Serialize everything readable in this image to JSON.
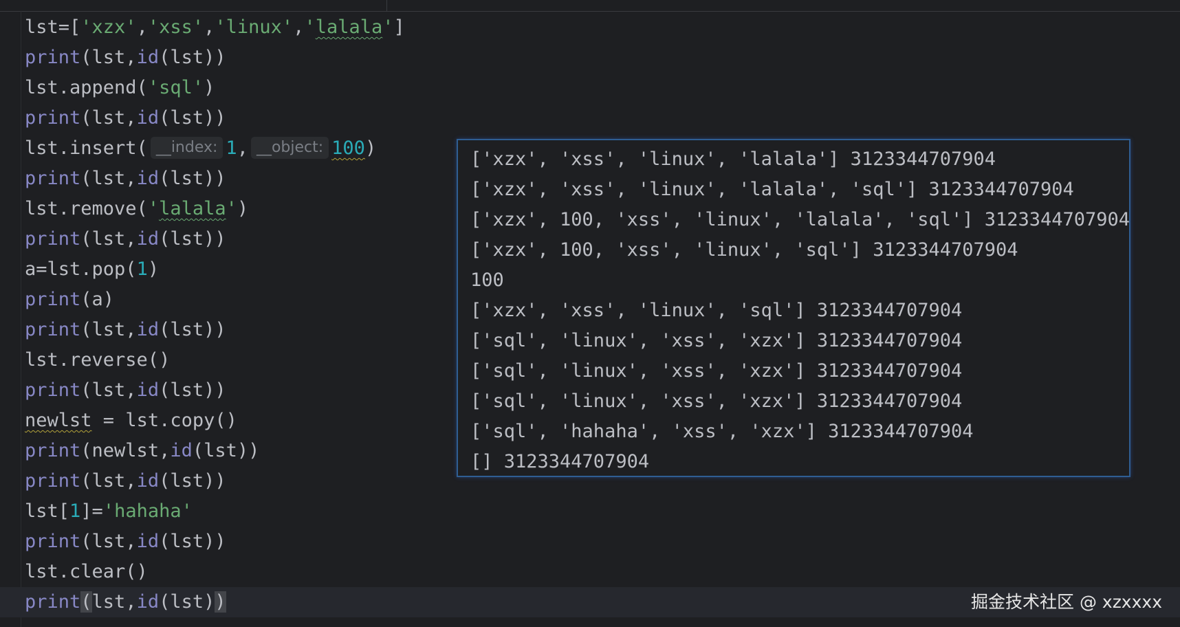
{
  "editor": {
    "lines": [
      [
        {
          "t": "lst=["
        },
        {
          "t": "'xzx'",
          "c": "str"
        },
        {
          "t": ","
        },
        {
          "t": "'xss'",
          "c": "str"
        },
        {
          "t": ","
        },
        {
          "t": "'linux'",
          "c": "str"
        },
        {
          "t": ","
        },
        {
          "t": "'",
          "c": "str"
        },
        {
          "t": "lalala",
          "c": "str squig-str"
        },
        {
          "t": "'",
          "c": "str"
        },
        {
          "t": "]"
        }
      ],
      [
        {
          "t": "print",
          "c": "kw"
        },
        {
          "t": "(lst,"
        },
        {
          "t": "id",
          "c": "kw"
        },
        {
          "t": "(lst))"
        }
      ],
      [
        {
          "t": "lst.append("
        },
        {
          "t": "'sql'",
          "c": "str"
        },
        {
          "t": ")"
        }
      ],
      [
        {
          "t": "print",
          "c": "kw"
        },
        {
          "t": "(lst,"
        },
        {
          "t": "id",
          "c": "kw"
        },
        {
          "t": "(lst))"
        }
      ],
      [
        {
          "t": "lst.insert("
        },
        {
          "t": "__index:",
          "c": "hint"
        },
        {
          "t": "1",
          "c": "num"
        },
        {
          "t": ","
        },
        {
          "t": "__object:",
          "c": "hint"
        },
        {
          "t": "100",
          "c": "num squig"
        },
        {
          "t": ")"
        }
      ],
      [
        {
          "t": "print",
          "c": "kw"
        },
        {
          "t": "(lst,"
        },
        {
          "t": "id",
          "c": "kw"
        },
        {
          "t": "(lst))"
        }
      ],
      [
        {
          "t": "lst.remove("
        },
        {
          "t": "'",
          "c": "str"
        },
        {
          "t": "lalala",
          "c": "str squig-str"
        },
        {
          "t": "'",
          "c": "str"
        },
        {
          "t": ")"
        }
      ],
      [
        {
          "t": "print",
          "c": "kw"
        },
        {
          "t": "(lst,"
        },
        {
          "t": "id",
          "c": "kw"
        },
        {
          "t": "(lst))"
        }
      ],
      [
        {
          "t": "a=lst.pop("
        },
        {
          "t": "1",
          "c": "num"
        },
        {
          "t": ")"
        }
      ],
      [
        {
          "t": "print",
          "c": "kw"
        },
        {
          "t": "(a)"
        }
      ],
      [
        {
          "t": "print",
          "c": "kw"
        },
        {
          "t": "(lst,"
        },
        {
          "t": "id",
          "c": "kw"
        },
        {
          "t": "(lst))"
        }
      ],
      [
        {
          "t": "lst.reverse()"
        }
      ],
      [
        {
          "t": "print",
          "c": "kw"
        },
        {
          "t": "(lst,"
        },
        {
          "t": "id",
          "c": "kw"
        },
        {
          "t": "(lst))"
        }
      ],
      [
        {
          "t": "newlst",
          "c": "squig"
        },
        {
          "t": " = lst.copy()"
        }
      ],
      [
        {
          "t": "print",
          "c": "kw"
        },
        {
          "t": "(newlst,"
        },
        {
          "t": "id",
          "c": "kw"
        },
        {
          "t": "(lst))"
        }
      ],
      [
        {
          "t": "print",
          "c": "kw"
        },
        {
          "t": "(lst,"
        },
        {
          "t": "id",
          "c": "kw"
        },
        {
          "t": "(lst))"
        }
      ],
      [
        {
          "t": "lst["
        },
        {
          "t": "1",
          "c": "num"
        },
        {
          "t": "]="
        },
        {
          "t": "'hahaha'",
          "c": "str"
        }
      ],
      [
        {
          "t": "print",
          "c": "kw"
        },
        {
          "t": "(lst,"
        },
        {
          "t": "id",
          "c": "kw"
        },
        {
          "t": "(lst))"
        }
      ],
      [
        {
          "t": "lst.clear()"
        }
      ],
      [
        {
          "t": "print",
          "c": "kw"
        },
        {
          "t": "(",
          "c": "caret-bracket"
        },
        {
          "t": "lst,"
        },
        {
          "t": "id",
          "c": "kw"
        },
        {
          "t": "(lst)"
        },
        {
          "t": ")",
          "c": "caret-bracket"
        }
      ]
    ]
  },
  "output": {
    "lines": [
      "['xzx', 'xss', 'linux', 'lalala'] 3123344707904",
      "['xzx', 'xss', 'linux', 'lalala', 'sql'] 3123344707904",
      "['xzx', 100, 'xss', 'linux', 'lalala', 'sql'] 3123344707904",
      "['xzx', 100, 'xss', 'linux', 'sql'] 3123344707904",
      "100",
      "['xzx', 'xss', 'linux', 'sql'] 3123344707904",
      "['sql', 'linux', 'xss', 'xzx'] 3123344707904",
      "['sql', 'linux', 'xss', 'xzx'] 3123344707904",
      "['sql', 'linux', 'xss', 'xzx'] 3123344707904",
      "['sql', 'hahaha', 'xss', 'xzx'] 3123344707904",
      "[] 3123344707904"
    ]
  },
  "watermark": "掘金技术社区 @ xzxxxx"
}
